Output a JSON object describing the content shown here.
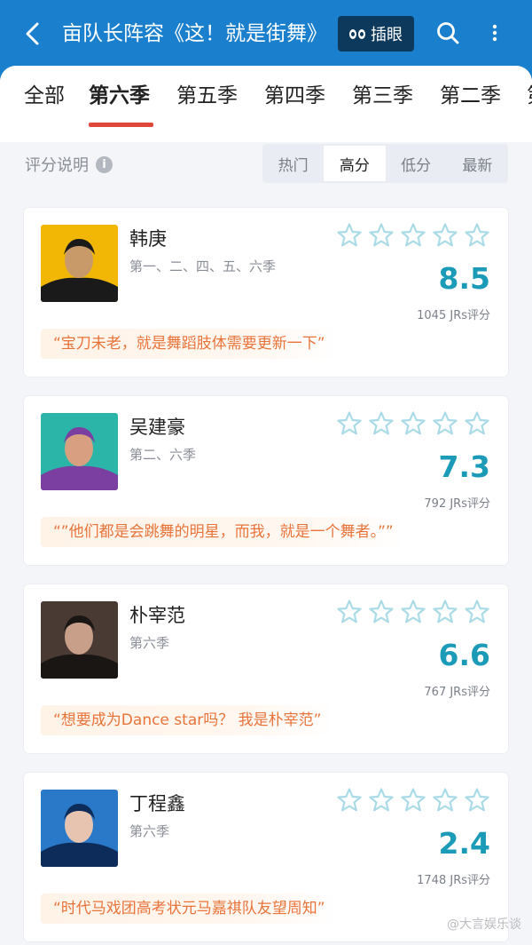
{
  "header": {
    "title": "亩队长阵容《这！就是街舞》",
    "insert_label": "插眼"
  },
  "tabs": [
    {
      "label": "全部",
      "active": false
    },
    {
      "label": "第六季",
      "active": true
    },
    {
      "label": "第五季",
      "active": false
    },
    {
      "label": "第四季",
      "active": false
    },
    {
      "label": "第三季",
      "active": false
    },
    {
      "label": "第二季",
      "active": false
    },
    {
      "label": "第",
      "active": false
    }
  ],
  "filter": {
    "rating_explain": "评分说明",
    "info_icon": "i",
    "sort_options": [
      {
        "label": "热门",
        "active": false
      },
      {
        "label": "高分",
        "active": true
      },
      {
        "label": "低分",
        "active": false
      },
      {
        "label": "最新",
        "active": false
      }
    ]
  },
  "cards": [
    {
      "name": "韩庚",
      "seasons": "第一、二、四、五、六季",
      "score": "8.5",
      "votes": "1045 JRs评分",
      "quote": "“宝刀未老，就是舞蹈肢体需要更新一下”",
      "avatar_colors": [
        "#f2b705",
        "#1a1a1a",
        "#c89a6a"
      ]
    },
    {
      "name": "吴建豪",
      "seasons": "第二、六季",
      "score": "7.3",
      "votes": "792 JRs评分",
      "quote": "“”他们都是会跳舞的明星，而我，就是一个舞者。””",
      "avatar_colors": [
        "#2bb5a8",
        "#7a3fa0",
        "#d8a080"
      ]
    },
    {
      "name": "朴宰范",
      "seasons": "第六季",
      "score": "6.6",
      "votes": "767 JRs评分",
      "quote": "“想要成为Dance star吗？ 我是朴宰范”",
      "avatar_colors": [
        "#4a3a34",
        "#1a1614",
        "#c8a08a"
      ]
    },
    {
      "name": "丁程鑫",
      "seasons": "第六季",
      "score": "2.4",
      "votes": "1748 JRs评分",
      "quote": "“时代马戏团高考状元马嘉祺队友望周知”",
      "avatar_colors": [
        "#2a78c8",
        "#0e2c5a",
        "#e6c4b0"
      ]
    }
  ],
  "star_color": "#aadbe6",
  "accent_red": "#e0463a",
  "score_color": "#1b9bb7",
  "watermark": "@大言娱乐谈"
}
